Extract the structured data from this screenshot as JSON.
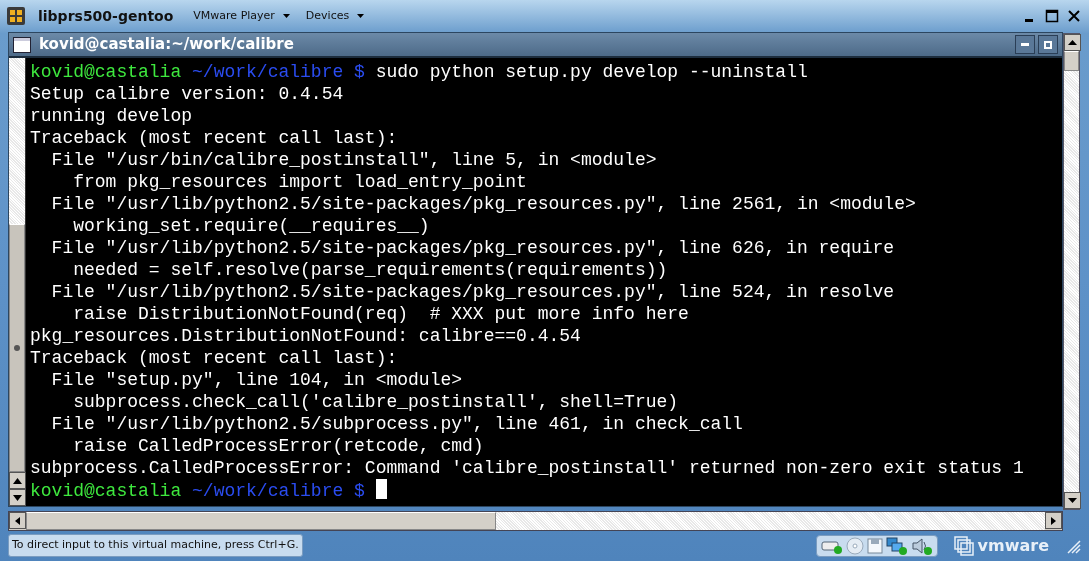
{
  "vm_window": {
    "title": "libprs500-gentoo",
    "menus": [
      {
        "label": "VMware Player"
      },
      {
        "label": "Devices"
      }
    ]
  },
  "terminal_window": {
    "title": "kovid@castalia:~/work/calibre"
  },
  "terminal": {
    "lines": [
      {
        "kind": "prompt",
        "user": "kovid@castalia",
        "path": "~/work/calibre $",
        "command": "sudo python setup.py develop --uninstall",
        "cursor": false
      },
      {
        "kind": "output",
        "text": "Setup calibre version: 0.4.54"
      },
      {
        "kind": "output",
        "text": "running develop"
      },
      {
        "kind": "output",
        "text": "Traceback (most recent call last):"
      },
      {
        "kind": "output",
        "text": "  File \"/usr/bin/calibre_postinstall\", line 5, in <module>"
      },
      {
        "kind": "output",
        "text": "    from pkg_resources import load_entry_point"
      },
      {
        "kind": "output",
        "text": "  File \"/usr/lib/python2.5/site-packages/pkg_resources.py\", line 2561, in <module>"
      },
      {
        "kind": "output",
        "text": "    working_set.require(__requires__)"
      },
      {
        "kind": "output",
        "text": "  File \"/usr/lib/python2.5/site-packages/pkg_resources.py\", line 626, in require"
      },
      {
        "kind": "output",
        "text": "    needed = self.resolve(parse_requirements(requirements))"
      },
      {
        "kind": "output",
        "text": "  File \"/usr/lib/python2.5/site-packages/pkg_resources.py\", line 524, in resolve"
      },
      {
        "kind": "output",
        "text": "    raise DistributionNotFound(req)  # XXX put more info here"
      },
      {
        "kind": "output",
        "text": "pkg_resources.DistributionNotFound: calibre==0.4.54"
      },
      {
        "kind": "output",
        "text": "Traceback (most recent call last):"
      },
      {
        "kind": "output",
        "text": "  File \"setup.py\", line 104, in <module>"
      },
      {
        "kind": "output",
        "text": "    subprocess.check_call('calibre_postinstall', shell=True)"
      },
      {
        "kind": "output",
        "text": "  File \"/usr/lib/python2.5/subprocess.py\", line 461, in check_call"
      },
      {
        "kind": "output",
        "text": "    raise CalledProcessError(retcode, cmd)"
      },
      {
        "kind": "output",
        "text": "subprocess.CalledProcessError: Command 'calibre_postinstall' returned non-zero exit status 1"
      },
      {
        "kind": "prompt",
        "user": "kovid@castalia",
        "path": "~/work/calibre $",
        "cursor": true
      }
    ]
  },
  "status_bar": {
    "hint": "To direct input to this virtual machine, press Ctrl+G.",
    "brand": "vmware"
  }
}
